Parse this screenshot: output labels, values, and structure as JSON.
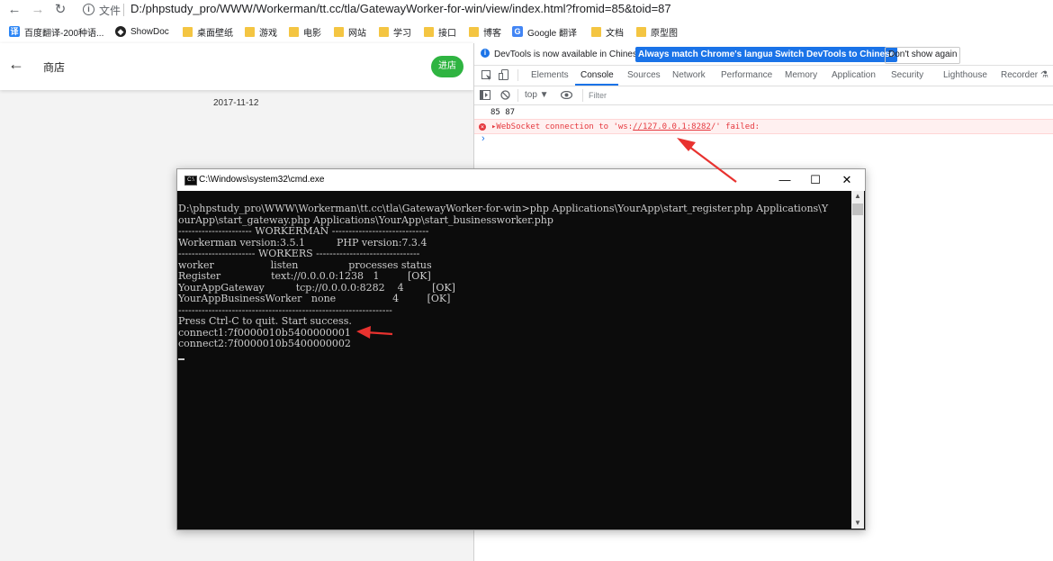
{
  "browser": {
    "file_label": "文件",
    "url": "D:/phpstudy_pro/WWW/Workerman/tt.cc/tla/GatewayWorker-for-win/view/index.html?fromid=85&toid=87"
  },
  "bookmarks": [
    {
      "label": "百度翻译-200种语...",
      "icon": "baidu-translate-icon",
      "color": "#2b85f5"
    },
    {
      "label": "ShowDoc",
      "icon": "showdoc-icon",
      "color": "#222222"
    },
    {
      "label": "桌面壁纸",
      "icon": "folder-icon"
    },
    {
      "label": "游戏",
      "icon": "folder-icon"
    },
    {
      "label": "电影",
      "icon": "folder-icon"
    },
    {
      "label": "网站",
      "icon": "folder-icon"
    },
    {
      "label": "学习",
      "icon": "folder-icon"
    },
    {
      "label": "接口",
      "icon": "folder-icon"
    },
    {
      "label": "博客",
      "icon": "folder-icon"
    },
    {
      "label": "Google 翻译",
      "icon": "google-translate-icon",
      "color": "#4285f4"
    },
    {
      "label": "文档",
      "icon": "folder-icon"
    },
    {
      "label": "原型图",
      "icon": "folder-icon"
    }
  ],
  "app": {
    "title": "商店",
    "enter_button": "进店",
    "date": "2017-11-12",
    "accent": "#2fb441"
  },
  "devtools": {
    "info_text": "DevTools is now available in Chinese!",
    "btn_match": "Always match Chrome's language",
    "btn_switch": "Switch DevTools to Chinese",
    "btn_dismiss": "Don't show again",
    "tabs": [
      "Elements",
      "Console",
      "Sources",
      "Network",
      "Performance",
      "Memory",
      "Application",
      "Security",
      "Lighthouse",
      "Recorder ⚗"
    ],
    "active_tab": "Console",
    "context": "top ▼",
    "filter_placeholder": "Filter",
    "log_line": "85 87",
    "error_prefix": "▸WebSocket connection to 'ws:",
    "error_link": "//127.0.0.1:8282",
    "error_suffix": "/' failed:",
    "prompt": "›"
  },
  "cmd": {
    "title": "C:\\Windows\\system32\\cmd.exe",
    "lines": [
      "D:\\phpstudy_pro\\WWW\\Workerman\\tt.cc\\tla\\GatewayWorker-for-win>php Applications\\YourApp\\start_register.php Applications\\Y",
      "ourApp\\start_gateway.php Applications\\YourApp\\start_businessworker.php",
      "---------------------- WORKERMAN -----------------------------",
      "Workerman version:3.5.1          PHP version:7.3.4",
      "----------------------- WORKERS -------------------------------",
      "worker                  listen                processes status",
      "Register                text://0.0.0.0:1238   1         [OK]",
      "YourAppGateway          tcp://0.0.0.0:8282    4         [OK]",
      "YourAppBusinessWorker   none                  4         [OK]",
      "----------------------------------------------------------------",
      "Press Ctrl-C to quit. Start success.",
      "connect1:7f0000010b5400000001",
      "connect2:7f0000010b5400000002"
    ]
  },
  "annotation_color": "#e8322f"
}
